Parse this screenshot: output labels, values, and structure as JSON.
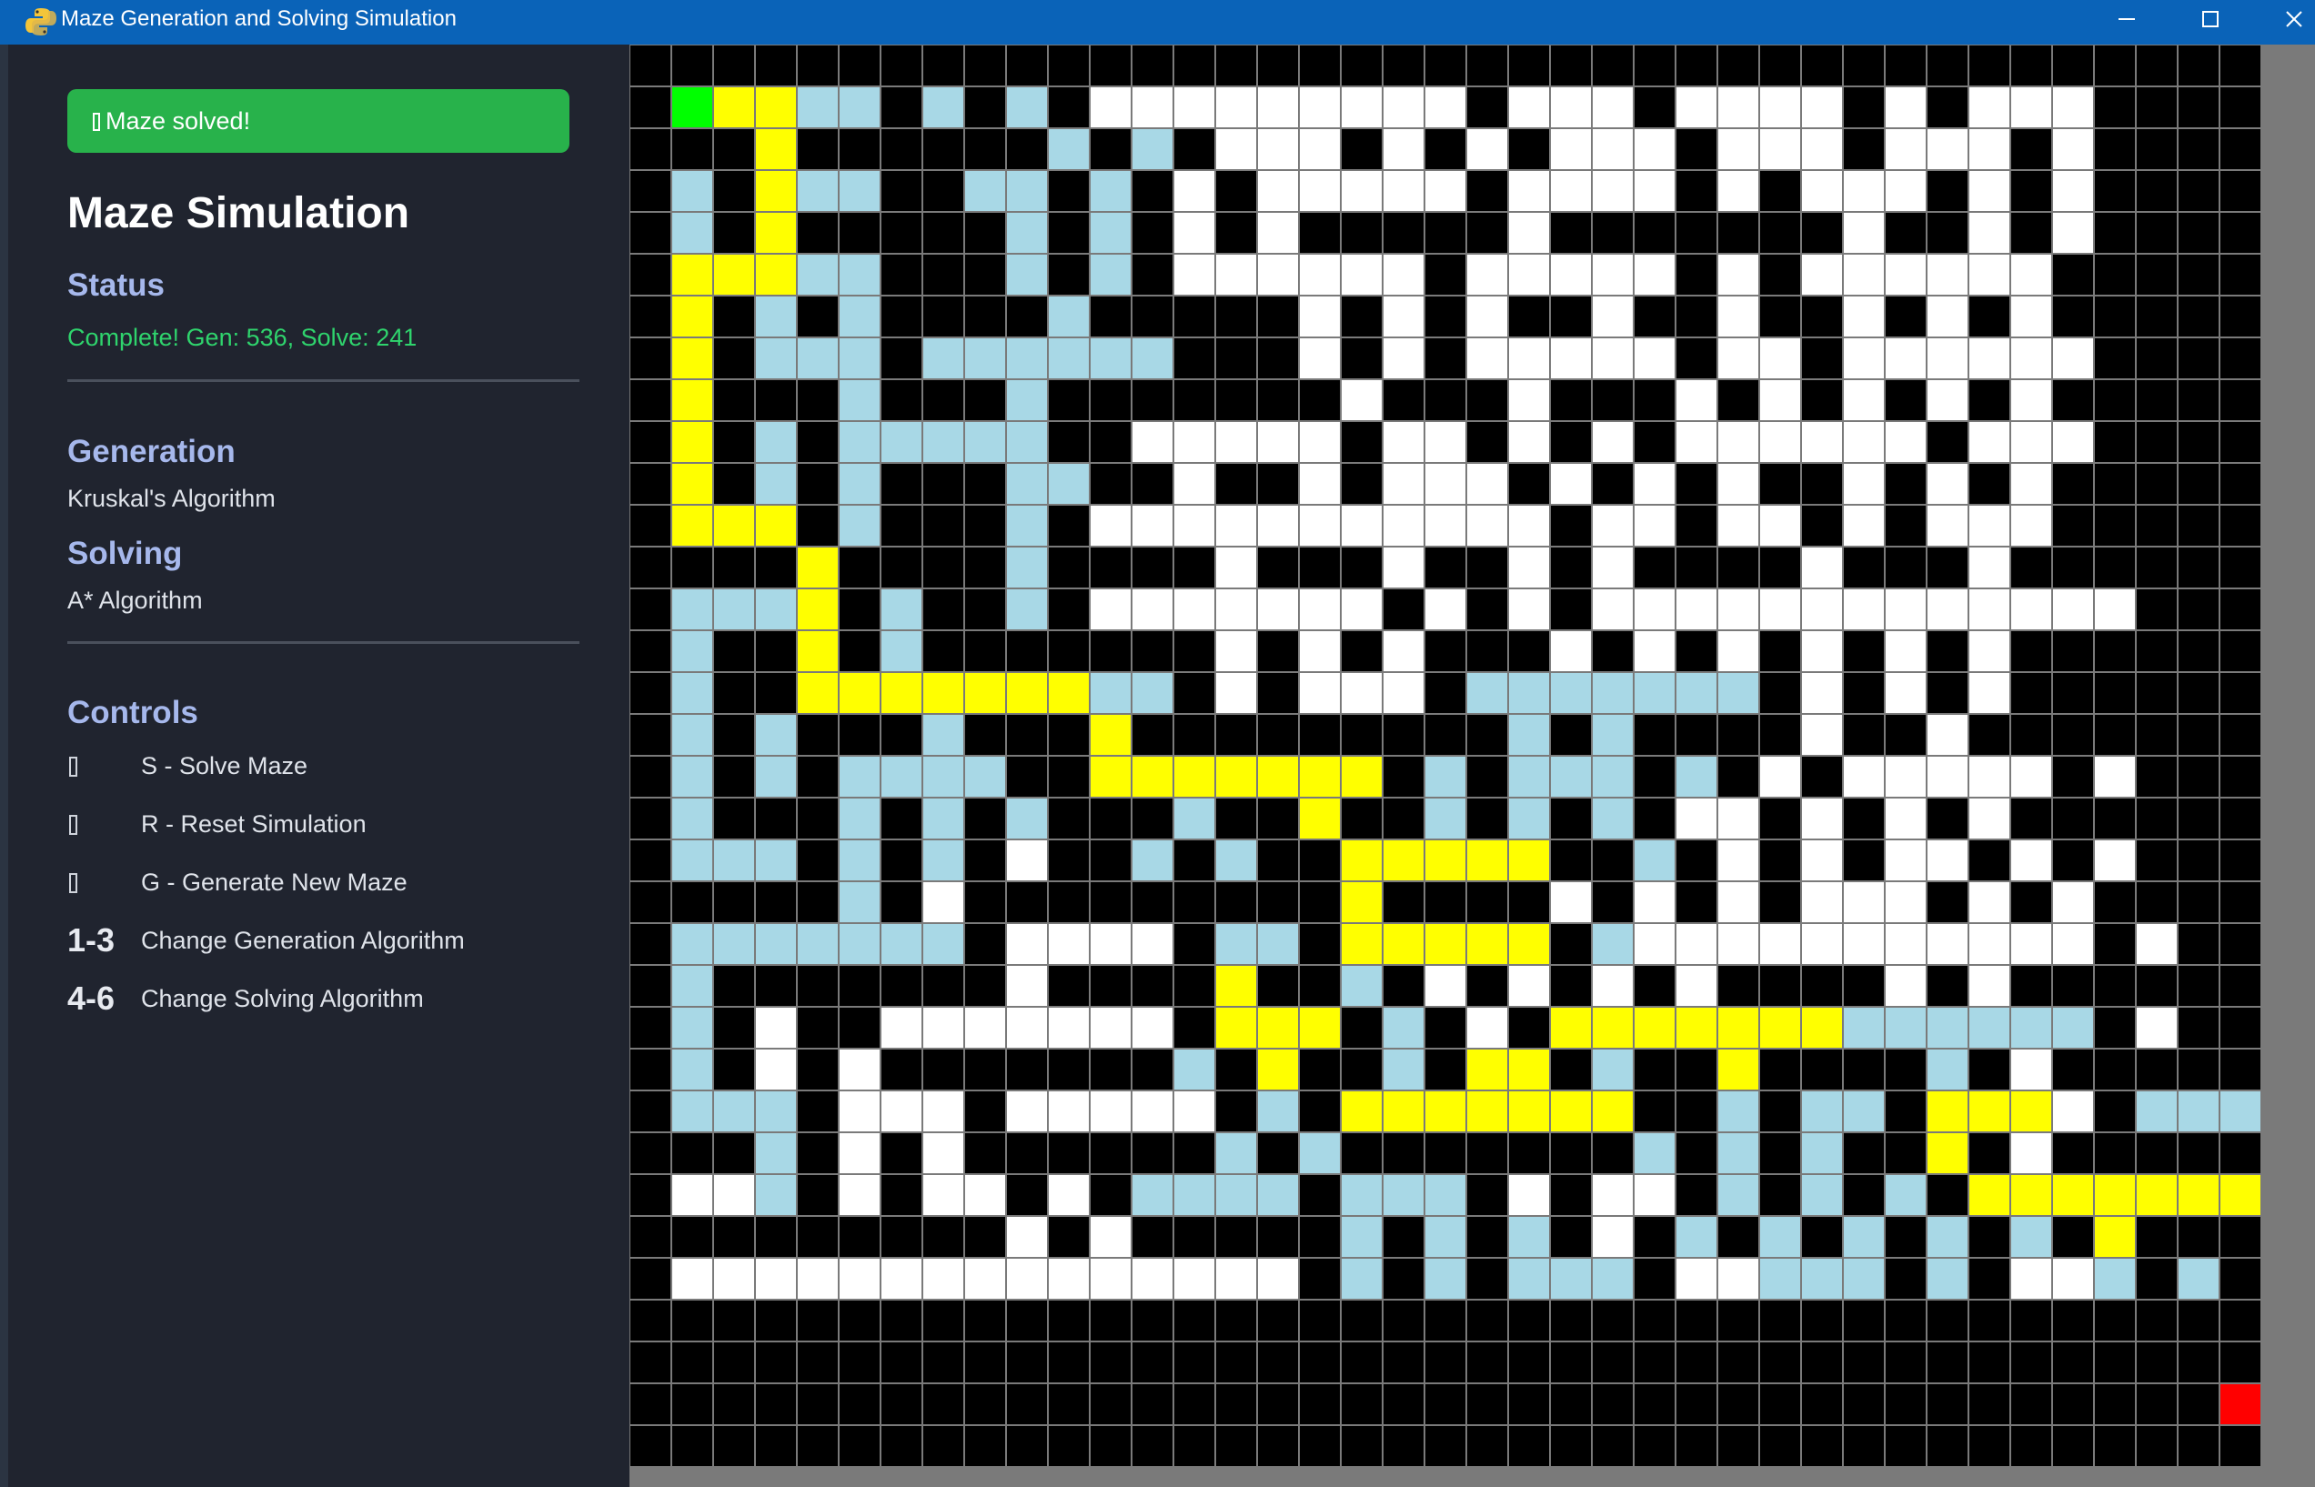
{
  "window": {
    "title": "Maze Generation and Solving Simulation",
    "app_icon": "python-icon",
    "controls": [
      "minimize-icon",
      "maximize-icon",
      "close-icon"
    ]
  },
  "sidebar": {
    "toast": "Maze solved!",
    "app_title": "Maze Simulation",
    "status_heading": "Status",
    "status_text": "Complete! Gen: 536, Solve: 241",
    "generation_heading": "Generation",
    "generation_value": "Kruskal's Algorithm",
    "solving_heading": "Solving",
    "solving_value": "A* Algorithm",
    "controls_heading": "Controls",
    "controls": [
      {
        "key": "",
        "label": "S - Solve Maze",
        "icon": "box-glyph"
      },
      {
        "key": "",
        "label": "R - Reset Simulation",
        "icon": "box-glyph"
      },
      {
        "key": "",
        "label": "G - Generate New Maze",
        "icon": "box-glyph"
      },
      {
        "key": "1-3",
        "label": "Change Generation Algorithm"
      },
      {
        "key": "4-6",
        "label": "Change Solving Algorithm"
      }
    ]
  },
  "maze": {
    "cols": 39,
    "rows": 34,
    "colors": {
      "wall": "#000000",
      "passage": "#ffffff",
      "explored": "#a8d8e6",
      "path": "#ffff00",
      "start": "#00ff00",
      "goal": "#ff0000",
      "grid": "#7a7a7a"
    },
    "legend": {
      "#": "wall",
      ".": "passage",
      "b": "explored",
      "y": "path",
      "s": "start",
      "e": "goal"
    },
    "grid": [
      "#######################################",
      "#syybb#b#b#.........#...#....#.#...###",
      "###y######b#b#...#.#.#...#...#...#.##",
      "#b#ybb##bb#b#.#.....#....#.#...#.#.##",
      "#b#y#####b#b#.#.#####.#######.##.#.##",
      "#yyybb###b#b#......#.....#.#......##",
      "#y#b#b####b#####.#.#.##.##.##.#.#.##",
      "#y#bbb#bbbbbb###.#.#.....#..#......##",
      "#y###b###b#######.###.###.#.#.#.#.##",
      "#y#b#bbbbb##.....#..#.#.#......#...##",
      "#y#b#b###bb##.##.#...#.#.#.##.#.#.##",
      "#yyy#b###b#...........#..#..#.#...##",
      "####y####b####.###.##.#.####.###.##",
      "#bbby#b##b#.......#.#.#.............##",
      "#b##y#b#######.#.#.###.#.#.#.#.#.##",
      "#b##yyyyyyybb#.#...#bbbbbbb#.#.#.##",
      "#b#b###b###y#########b#b####.##.###",
      "#b#b#bbbb##yyyyyyy#b#bbb#b#.#.....#.#",
      "#b###b#b#b###b##y##b#b#b#..#.#.#.#",
      "#bbb#b#b#.##b#b##yyyyy##b#.#.#..#.#.#",
      "#####b#.#########y####.#.#.#...#.#.##",
      "#bbbbbbb#....#bb#yyyyy#b...........#.#",
      "#b#######.####y##b#.#.#.#.####.#.##",
      "#b#.##.......#yyy#b#.#yyyyyyybbbbbb#.#",
      "#b#.#.#######b#y##b#yy#b##y####b#.#",
      "#bbb#...#.....#b#yyyyyyy##b#bb#yyy.#bbb",
      "###b#.#.######b#b#######b#b#b##y#.##",
      "#..b#.#..#.#bbbb#bbb#.#..#b#b#b#yyyyyyy#",
      "#########.#.#####b#b#b#.#b#b#b#b#b#y#",
      "#...............#b#b#bbb#..bbb#b#..b#b#ye",
      "#######################################",
      "#######################################",
      "######################################e",
      "#######################################"
    ]
  }
}
